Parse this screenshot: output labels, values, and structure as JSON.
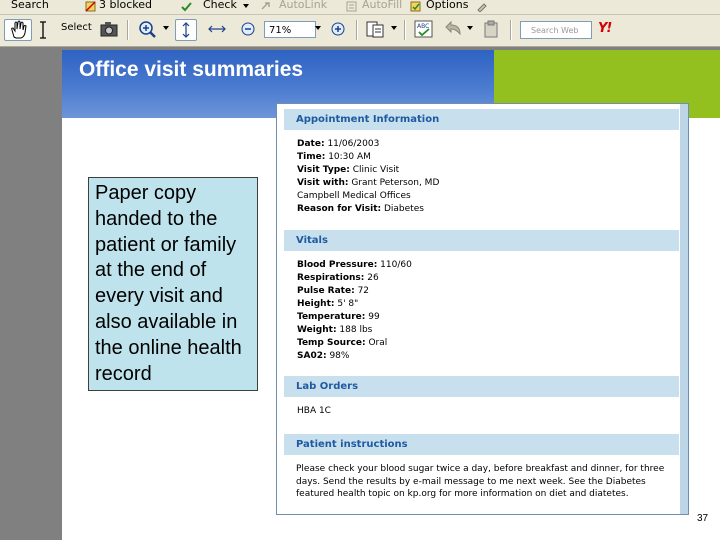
{
  "menubar": {
    "search": "Search",
    "blocked": "3 blocked",
    "check": "Check",
    "autolink": "AutoLink",
    "autofill": "AutoFill",
    "options": "Options"
  },
  "toolbar": {
    "select_label": "Select",
    "zoom_value": "71%",
    "search_placeholder": "Search Web",
    "yahoo": "Y!"
  },
  "slide": {
    "title": "Office visit summaries",
    "callout": "Paper copy handed to the patient or family at the end of every visit and also available in the online health record",
    "page_number": "37"
  },
  "summary": {
    "appointment": {
      "heading": "Appointment Information",
      "rows": [
        {
          "label": "Date:",
          "value": "11/06/2003"
        },
        {
          "label": "Time:",
          "value": "10:30 AM"
        },
        {
          "label": "Visit Type:",
          "value": "Clinic Visit"
        },
        {
          "label": "Visit with:",
          "value": "Grant Peterson, MD"
        },
        {
          "label": "",
          "value": "Campbell Medical Offices"
        },
        {
          "label": "Reason for Visit:",
          "value": "Diabetes"
        }
      ]
    },
    "vitals": {
      "heading": "Vitals",
      "rows": [
        {
          "label": "Blood Pressure:",
          "value": "110/60"
        },
        {
          "label": "Respirations:",
          "value": "26"
        },
        {
          "label": "Pulse Rate:",
          "value": "72"
        },
        {
          "label": "Height:",
          "value": "5' 8\""
        },
        {
          "label": "Temperature:",
          "value": "99"
        },
        {
          "label": "Weight:",
          "value": "188 lbs"
        },
        {
          "label": "Temp Source:",
          "value": "Oral"
        },
        {
          "label": "SA02:",
          "value": "98%"
        }
      ]
    },
    "lab_orders": {
      "heading": "Lab Orders",
      "item": "HBA 1C"
    },
    "instructions": {
      "heading": "Patient instructions",
      "text": "Please check your blood sugar twice a day, before breakfast and dinner, for three days. Send the results by e-mail message to me next week. See the Diabetes featured health topic on kp.org for more information on diet and diatetes."
    }
  }
}
